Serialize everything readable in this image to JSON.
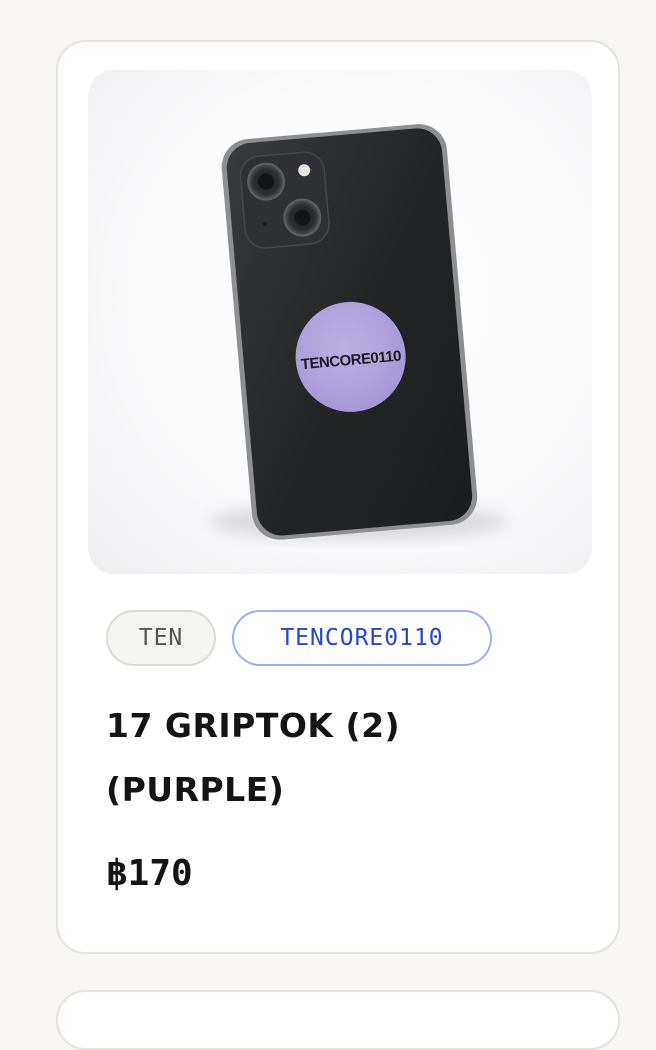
{
  "product": {
    "image_alt": "Phone with purple griptok",
    "griptok_text": "TENCORE0110",
    "tags": {
      "artist": "TEN",
      "collection": "TENCORE0110"
    },
    "title": "17 GRIPTOK (2) (PURPLE)",
    "price": "฿170"
  },
  "colors": {
    "page_background": "#f6f5f3",
    "card_background": "#ffffff",
    "card_border": "#e6e3de",
    "griptok_purple": "#b0a2dc",
    "collection_tag_text": "#2946cc",
    "collection_tag_border": "#9fb0e6"
  }
}
